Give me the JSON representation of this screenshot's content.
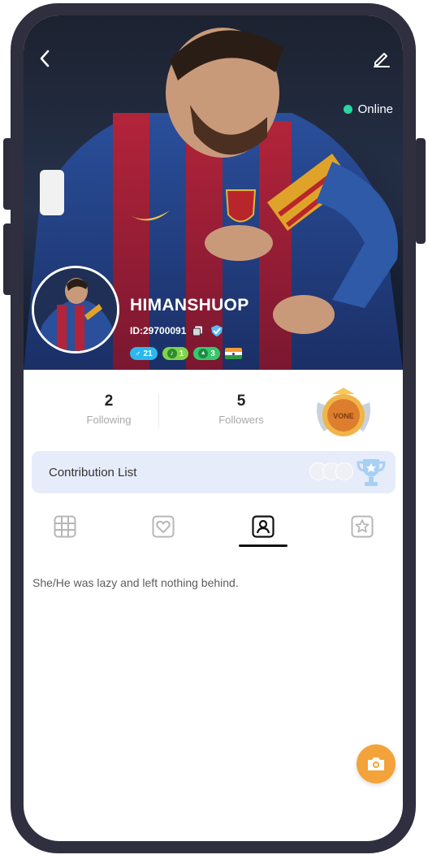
{
  "header": {
    "back_icon": "chevron-left-icon",
    "edit_icon": "pencil-icon",
    "status_text": "Online",
    "status_color": "#28d7a0"
  },
  "profile": {
    "username": "HIMANSHUOP",
    "id_text": "ID:29700091",
    "badges": [
      {
        "icon": "male-symbol-icon",
        "text": "21",
        "color": "#2bb8f0"
      },
      {
        "icon": "music-note-icon",
        "text": "1",
        "color": "#7fd44a"
      },
      {
        "icon": "triangle-icon",
        "text": "3",
        "color": "#37c86a"
      }
    ],
    "country_flag": "india-flag"
  },
  "stats": {
    "following_count": "2",
    "following_label": "Following",
    "followers_count": "5",
    "followers_label": "Followers",
    "medal_text": "VONE"
  },
  "contribution": {
    "title": "Contribution List"
  },
  "tabs": [
    {
      "icon": "grid-icon",
      "active": false
    },
    {
      "icon": "heart-icon",
      "active": false
    },
    {
      "icon": "person-icon",
      "active": true
    },
    {
      "icon": "star-icon",
      "active": false
    }
  ],
  "content": {
    "empty_text": "She/He was lazy and left nothing behind."
  },
  "fab": {
    "icon": "camera-icon",
    "color": "#f3a33a"
  }
}
